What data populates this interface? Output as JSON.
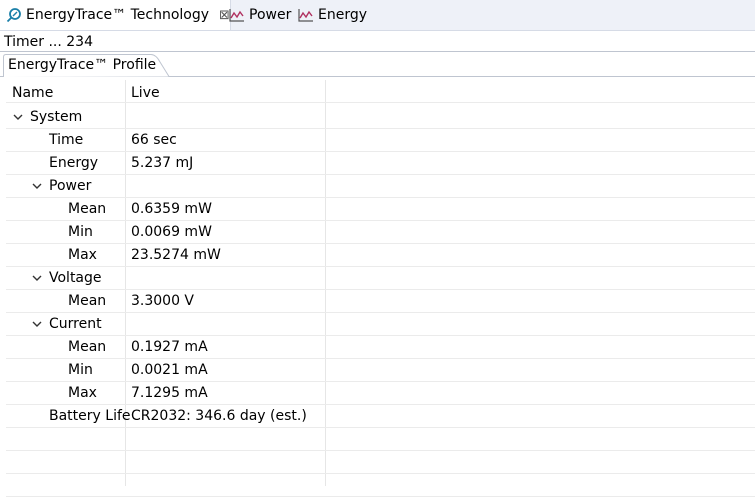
{
  "tabs": [
    {
      "label": "EnergyTrace™ Technology",
      "icon": "energytrace-icon",
      "active": true,
      "closable": true
    },
    {
      "label": "Power",
      "icon": "chart-icon",
      "active": false
    },
    {
      "label": "Energy",
      "icon": "chart-icon",
      "active": false
    }
  ],
  "status_text": "Timer ... 234",
  "profile_tab": {
    "label": "EnergyTrace™ Profile"
  },
  "table": {
    "columns": [
      "Name",
      "Live"
    ],
    "rows": [
      {
        "name": "System",
        "value": "",
        "level": 0,
        "expanded": true
      },
      {
        "name": "Time",
        "value": "66 sec",
        "level": 1
      },
      {
        "name": "Energy",
        "value": "5.237 mJ",
        "level": 1
      },
      {
        "name": "Power",
        "value": "",
        "level": 1,
        "expanded": true
      },
      {
        "name": "Mean",
        "value": "0.6359 mW",
        "level": 2
      },
      {
        "name": "Min",
        "value": "0.0069 mW",
        "level": 2
      },
      {
        "name": "Max",
        "value": "23.5274 mW",
        "level": 2
      },
      {
        "name": "Voltage",
        "value": "",
        "level": 1,
        "expanded": true
      },
      {
        "name": "Mean",
        "value": "3.3000 V",
        "level": 2
      },
      {
        "name": "Current",
        "value": "",
        "level": 1,
        "expanded": true
      },
      {
        "name": "Mean",
        "value": "0.1927 mA",
        "level": 2
      },
      {
        "name": "Min",
        "value": "0.0021 mA",
        "level": 2
      },
      {
        "name": "Max",
        "value": "7.1295 mA",
        "level": 2
      },
      {
        "name": "Battery Life",
        "value": "CR2032: 346.6 day (est.)",
        "level": 1
      }
    ]
  },
  "colors": {
    "tabbar_bg": "#eef1f8",
    "accent": "#1a7fa8",
    "chart_icon": "#b03060"
  }
}
